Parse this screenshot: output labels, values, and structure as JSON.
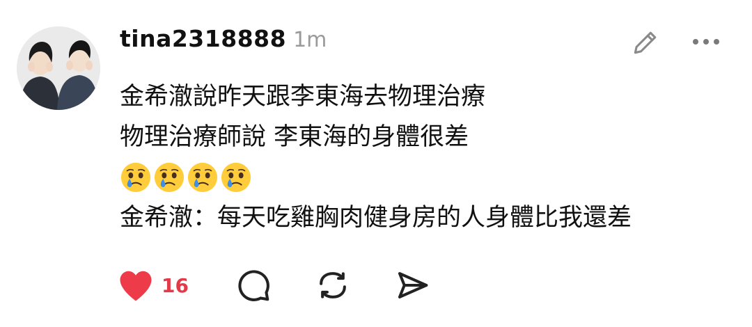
{
  "post": {
    "author": {
      "username": "tina2318888",
      "avatar_icon": "avatar-photo"
    },
    "timestamp": "1m",
    "lines": [
      "金希澈說昨天跟李東海去物理治療",
      "物理治療師說 李東海的身體很差",
      "金希澈：每天吃雞胸肉健身房的人身體比我還差"
    ],
    "emoji_row": {
      "emoji_icon": "crying-face-emoji",
      "count": 4
    }
  },
  "header_actions": {
    "edit_icon": "pencil-icon",
    "more_icon": "more-dots-icon"
  },
  "actions": {
    "like": {
      "icon": "heart-icon",
      "count": "16",
      "color": "#ee3b4a",
      "liked": true
    },
    "reply_icon": "comment-icon",
    "repost_icon": "repost-icon",
    "share_icon": "send-icon"
  }
}
